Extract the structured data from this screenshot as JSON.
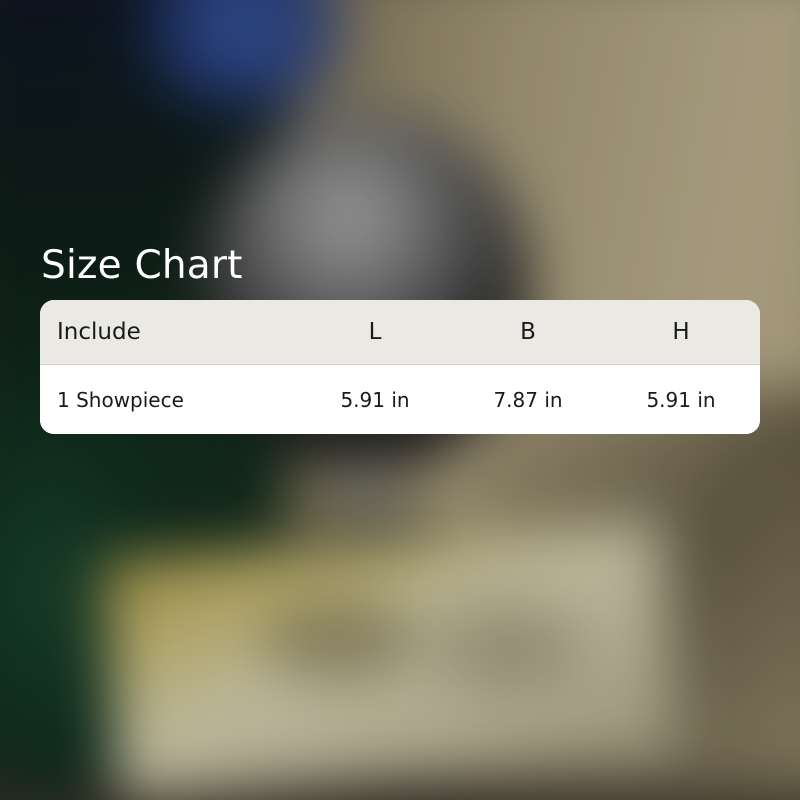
{
  "title": "Size Chart",
  "table": {
    "headers": [
      "Include",
      "L",
      "B",
      "H"
    ],
    "rows": [
      [
        "1 Showpiece",
        "5.91 in",
        "7.87 in",
        "5.91 in"
      ]
    ]
  },
  "colors": {
    "title_text": "#ffffff",
    "header_background": "#ebe9e3",
    "body_background": "#ffffff",
    "cell_text": "#1a1a1a"
  }
}
